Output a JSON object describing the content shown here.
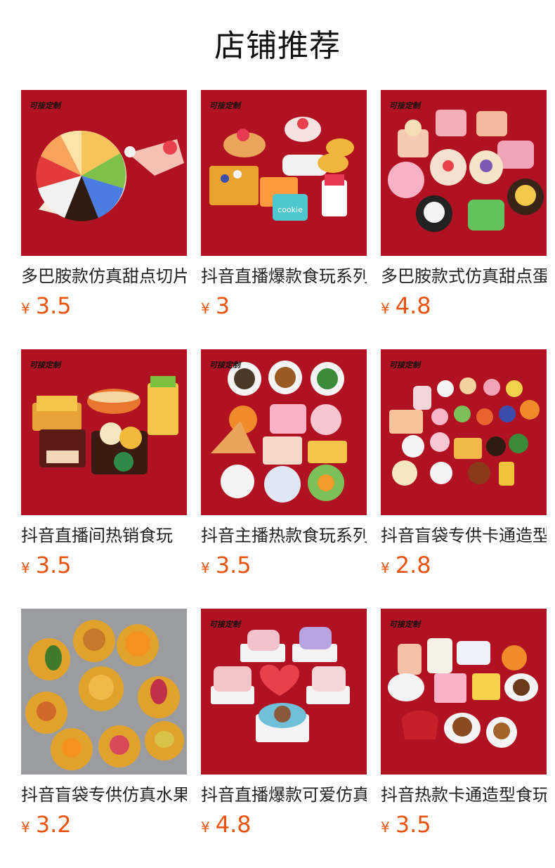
{
  "header": {
    "title": "店铺推荐"
  },
  "colors": {
    "price": "#e8530f",
    "thumb_red": "#b01222",
    "thumb_grey": "#9a9ca0"
  },
  "products": [
    {
      "name": "多巴胺款仿真甜点切片",
      "currency": "¥",
      "price": "3.5",
      "tag": "可接定制",
      "icon": "cake-slice-image"
    },
    {
      "name": "抖音直播爆款食玩系列",
      "currency": "¥",
      "price": "3",
      "tag": "可接定制",
      "icon": "dessert-mix-image"
    },
    {
      "name": "多巴胺款式仿真甜点蛋糕",
      "currency": "¥",
      "price": "4.8",
      "tag": "可接定制",
      "icon": "round-cakes-image"
    },
    {
      "name": "抖音直播间热销食玩",
      "currency": "¥",
      "price": "3.5",
      "tag": "可接定制",
      "icon": "fast-food-image"
    },
    {
      "name": "抖音主播热款食玩系列",
      "currency": "¥",
      "price": "3.5",
      "tag": "可接定制",
      "icon": "food-plates-image"
    },
    {
      "name": "抖音盲袋专供卡通造型",
      "currency": "¥",
      "price": "2.8",
      "tag": "可接定制",
      "icon": "mini-foods-image"
    },
    {
      "name": "抖音盲袋专供仿真水果",
      "currency": "¥",
      "price": "3.2",
      "tag": "",
      "icon": "fruit-baskets-image"
    },
    {
      "name": "抖音直播爆款可爱仿真",
      "currency": "¥",
      "price": "4.8",
      "tag": "可接定制",
      "icon": "birthday-cakes-image"
    },
    {
      "name": "抖音热款卡通造型食玩",
      "currency": "¥",
      "price": "3.5",
      "tag": "可接定制",
      "icon": "cups-teapots-image"
    }
  ]
}
